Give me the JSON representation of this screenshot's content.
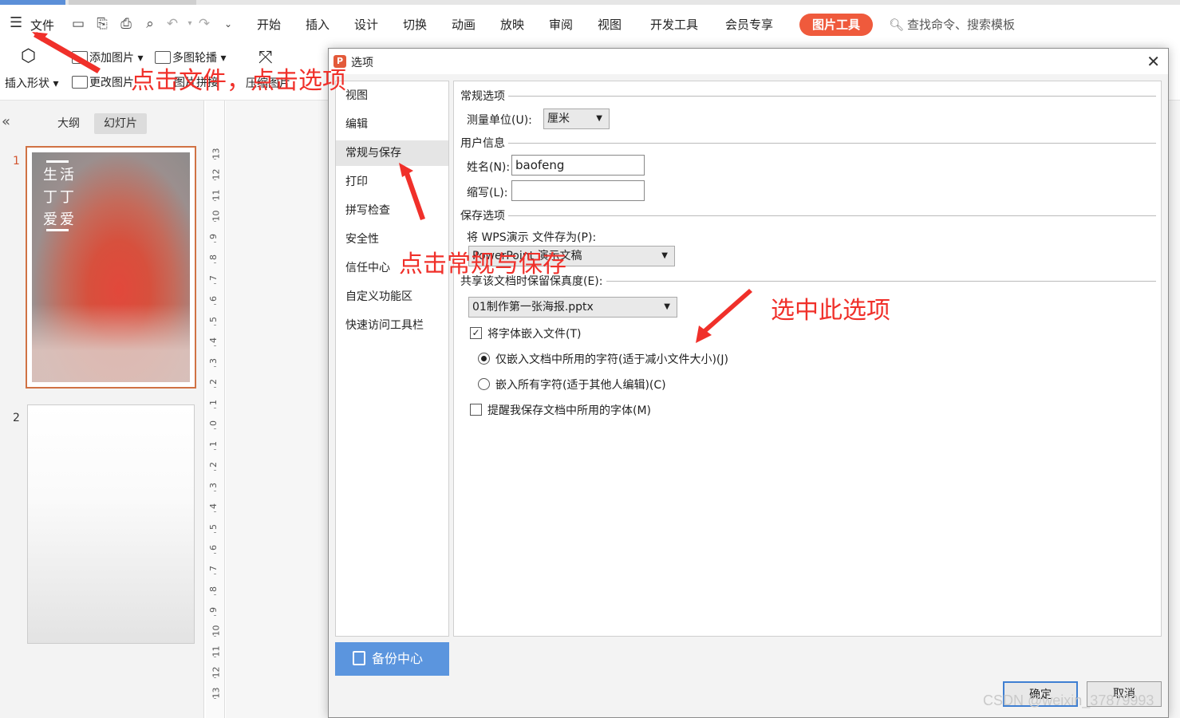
{
  "app": {
    "file_menu": "文件",
    "menu_tabs": [
      "开始",
      "插入",
      "设计",
      "切换",
      "动画",
      "放映",
      "审阅",
      "视图",
      "开发工具",
      "会员专享"
    ],
    "picture_tools_badge": "图片工具",
    "search_placeholder": "查找命令、搜索模板",
    "accent_color": "#ef5a3c"
  },
  "ribbon": {
    "insert_shape": "插入形状",
    "add_picture": "添加图片",
    "change_picture": "更改图片",
    "multi_picture_carousel": "多图轮播",
    "compress_picture": "压缩图片",
    "picture_stitch": "图片拼接"
  },
  "left_panel": {
    "tab_outline": "大纲",
    "tab_slides": "幻灯片",
    "slide1_number": "1",
    "slide2_number": "2",
    "slide1_caption": [
      "生活",
      "丁丁",
      "爱爱"
    ]
  },
  "ruler": {
    "labels": [
      "13",
      "12",
      "11",
      "10",
      "9",
      "8",
      "7",
      "6",
      "5",
      "4",
      "3",
      "2",
      "1",
      "0",
      "1",
      "2",
      "3",
      "4",
      "5",
      "6",
      "7",
      "8",
      "9",
      "10",
      "11",
      "12",
      "13"
    ]
  },
  "dialog": {
    "title": "选项",
    "nav": [
      "视图",
      "编辑",
      "常规与保存",
      "打印",
      "拼写检查",
      "安全性",
      "信任中心",
      "自定义功能区",
      "快速访问工具栏"
    ],
    "backup_center": "备份中心",
    "general_section": "常规选项",
    "measure_unit_label": "测量单位(U):",
    "measure_unit_value": "厘米",
    "user_info_section": "用户信息",
    "name_label": "姓名(N):",
    "name_value": "baofeng",
    "initials_label": "缩写(L):",
    "initials_value": "",
    "save_section": "保存选项",
    "save_as_label": "将 WPS演示 文件存为(P):",
    "save_as_value": "PowerPoint 演示文稿",
    "share_label": "共享该文档时保留保真度(E):",
    "share_file_value": "01制作第一张海报.pptx",
    "embed_fonts_label": "将字体嵌入文件(T)",
    "embed_fonts_checked": true,
    "embed_used_label": "仅嵌入文档中所用的字符(适于减小文件大小)(J)",
    "embed_all_label": "嵌入所有字符(适于其他人编辑)(C)",
    "remind_label": "提醒我保存文档中所用的字体(M)",
    "ok": "确定",
    "cancel": "取消"
  },
  "annotations": {
    "click_file_options": "点击文件，点击选项",
    "click_general_save": "点击常规与保存",
    "select_this_option": "选中此选项"
  },
  "watermark": "CSDN @weixin_37879993"
}
